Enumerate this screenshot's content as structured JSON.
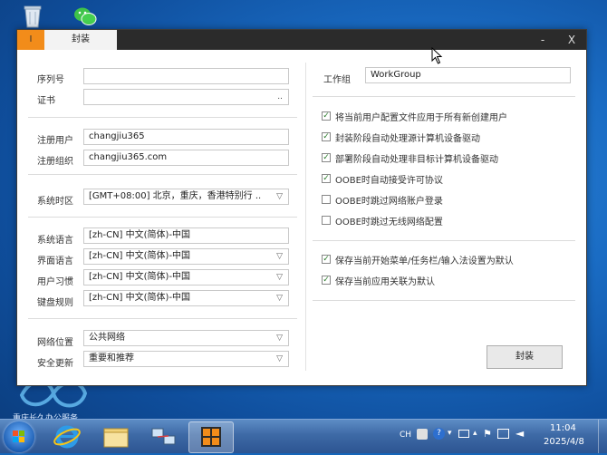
{
  "window": {
    "app_icon_label": "I",
    "tab_label": "封装",
    "minimize_label": "-",
    "maximize_label": "□",
    "close_label": "X"
  },
  "left": {
    "serial_label": "序列号",
    "serial_value": "",
    "cert_label": "证书",
    "cert_value": "",
    "cert_browse": "..",
    "reg_user_label": "注册用户",
    "reg_user_value": "changjiu365",
    "reg_org_label": "注册组织",
    "reg_org_value": "changjiu365.com",
    "timezone_label": "系统时区",
    "timezone_value": "[GMT+08:00] 北京，重庆，香港特别行 ..",
    "sys_lang_label": "系统语言",
    "sys_lang_value": "[zh-CN] 中文(简体)-中国",
    "ui_lang_label": "界面语言",
    "ui_lang_value": "[zh-CN] 中文(简体)-中国",
    "user_locale_label": "用户习惯",
    "user_locale_value": "[zh-CN] 中文(简体)-中国",
    "keyboard_label": "键盘规则",
    "keyboard_value": "[zh-CN] 中文(简体)-中国",
    "network_label": "网络位置",
    "network_value": "公共网络",
    "update_label": "安全更新",
    "update_value": "重要和推荐"
  },
  "right": {
    "workgroup_label": "工作组",
    "workgroup_value": "WorkGroup",
    "options": [
      {
        "label": "将当前用户配置文件应用于所有新创建用户",
        "checked": true
      },
      {
        "label": "封装阶段自动处理源计算机设备驱动",
        "checked": true
      },
      {
        "label": "部署阶段自动处理非目标计算机设备驱动",
        "checked": true
      },
      {
        "label": "OOBE时自动接受许可协议",
        "checked": true
      },
      {
        "label": "OOBE时跳过网络账户登录",
        "checked": false
      },
      {
        "label": "OOBE时跳过无线网络配置",
        "checked": false
      }
    ],
    "options2": [
      {
        "label": "保存当前开始菜单/任务栏/输入法设置为默认",
        "checked": true
      },
      {
        "label": "保存当前应用关联为默认",
        "checked": true
      }
    ],
    "seal_button": "封装"
  },
  "desktop": {
    "watermark_text": "重庆长久办公服务"
  },
  "taskbar": {
    "ime_label": "CH",
    "time": "11:04",
    "date": "2025/4/8"
  },
  "colors": {
    "accent_orange": "#f28c1a",
    "titlebar": "#2b2b2b",
    "check_green": "#2a7a2a"
  }
}
